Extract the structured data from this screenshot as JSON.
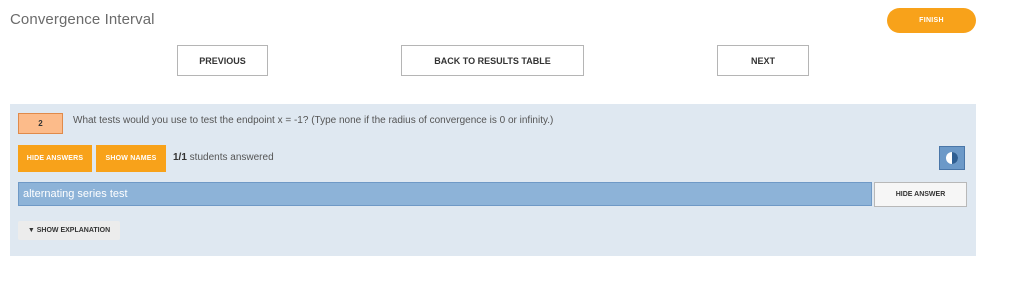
{
  "header": {
    "title": "Convergence Interval",
    "finish_label": "FINISH"
  },
  "nav": {
    "previous_label": "PREVIOUS",
    "back_label": "BACK TO RESULTS TABLE",
    "next_label": "NEXT"
  },
  "question": {
    "number": "2",
    "text": "What tests would you use to test the endpoint x = -1? (Type none if the radius of convergence is 0 or infinity.)",
    "hide_answers_label": "HIDE ANSWERS",
    "show_names_label": "SHOW NAMES",
    "answered_count": "1/1",
    "answered_suffix": " students answered",
    "icon": "half-circle-toggle-icon",
    "answer": "alternating series test",
    "hide_answer_label": "HIDE ANSWER",
    "explanation_label": "▼ SHOW EXPLANATION"
  },
  "colors": {
    "accent_orange": "#f8a21a",
    "panel_bg": "#dfe8f1",
    "answer_bar": "#8db3d8"
  }
}
